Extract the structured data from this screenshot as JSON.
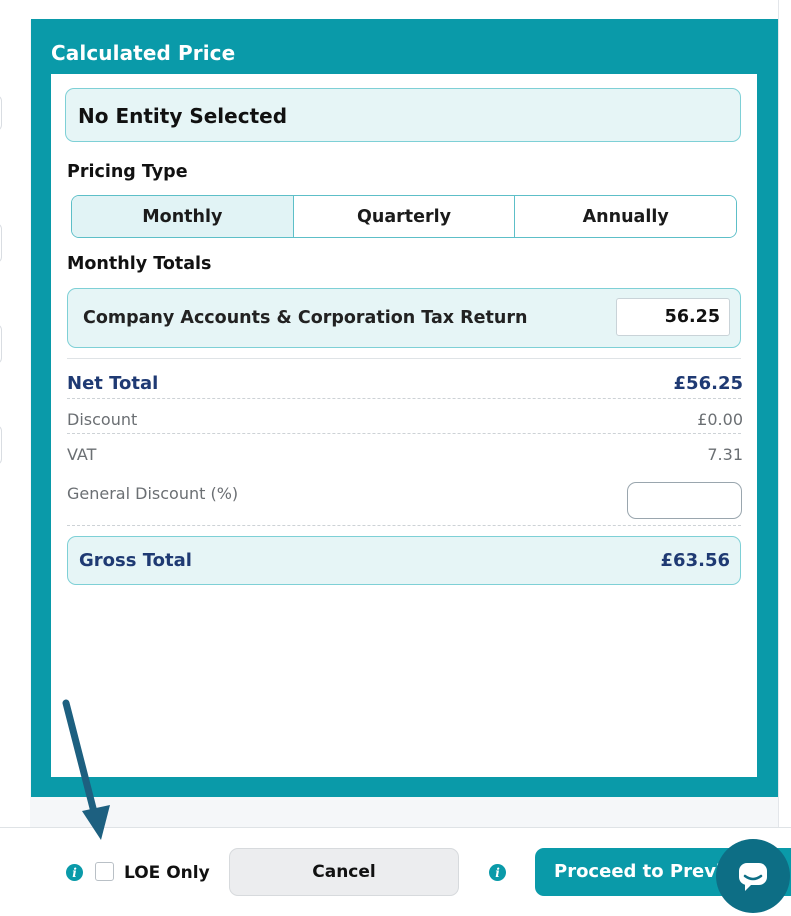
{
  "panel": {
    "title": "Calculated Price",
    "entity": "No Entity Selected"
  },
  "pricing": {
    "label": "Pricing Type",
    "options": [
      "Monthly",
      "Quarterly",
      "Annually"
    ],
    "selected": "Monthly"
  },
  "totals": {
    "label": "Monthly Totals",
    "line_item_label": "Company Accounts & Corporation Tax Return",
    "line_item_value": "56.25",
    "net_label": "Net Total",
    "net_value": "£56.25",
    "discount_label": "Discount",
    "discount_value": "£0.00",
    "vat_label": "VAT",
    "vat_value": "7.31",
    "general_discount_label": "General Discount (%)",
    "general_discount_value": "",
    "gross_label": "Gross Total",
    "gross_value": "£63.56"
  },
  "footer": {
    "loe_label": "LOE Only",
    "cancel_label": "Cancel",
    "proceed_label": "Proceed to Preview"
  },
  "colors": {
    "accent": "#0a9aa9",
    "accent_light": "#e6f5f6",
    "heading_blue": "#1f3a73",
    "arrow": "#1d6080",
    "chat": "#0d6e85"
  }
}
